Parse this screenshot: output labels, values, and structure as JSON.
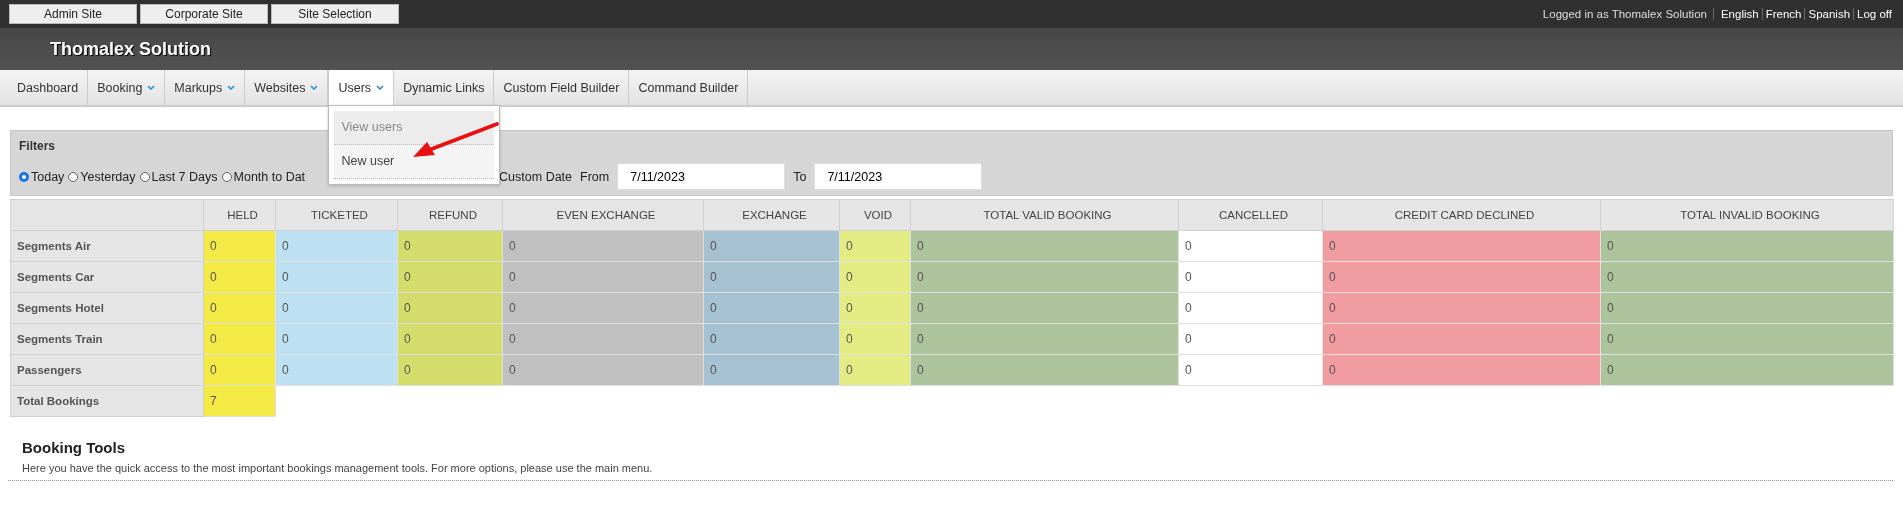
{
  "top_bar": {
    "site_buttons": [
      "Admin Site",
      "Corporate Site",
      "Site Selection"
    ],
    "logged_in": "Logged in as Thomalex Solution",
    "links": [
      "English",
      "French",
      "Spanish",
      "Log off"
    ]
  },
  "header": {
    "title": "Thomalex Solution"
  },
  "nav": [
    {
      "label": "Dashboard",
      "has_menu": false,
      "selected": false
    },
    {
      "label": "Booking",
      "has_menu": true,
      "selected": false
    },
    {
      "label": "Markups",
      "has_menu": true,
      "selected": false
    },
    {
      "label": "Websites",
      "has_menu": true,
      "selected": false
    },
    {
      "label": "Users",
      "has_menu": true,
      "selected": true,
      "menu": [
        {
          "label": "View users",
          "disabled": true
        },
        {
          "label": "New user",
          "disabled": false
        }
      ]
    },
    {
      "label": "Dynamic Links",
      "has_menu": false,
      "selected": false
    },
    {
      "label": "Custom Field Builder",
      "has_menu": false,
      "selected": false
    },
    {
      "label": "Command Builder",
      "has_menu": false,
      "selected": false
    }
  ],
  "filters": {
    "title": "Filters",
    "options": [
      {
        "kind": "radio",
        "label": "Today",
        "selected": true
      },
      {
        "kind": "radio",
        "label": "Yesterday",
        "selected": false
      },
      {
        "kind": "radio",
        "label": "Last 7 Days",
        "selected": false
      },
      {
        "kind": "radio",
        "label": "Month to Dat",
        "selected": false
      },
      {
        "kind": "label",
        "label": "Custom Date"
      }
    ],
    "from_label": "From",
    "from_value": "7/11/2023",
    "to_label": "To",
    "to_value": "7/11/2023"
  },
  "table": {
    "columns": [
      {
        "label": "HELD",
        "color": "#f3ea45"
      },
      {
        "label": "TICKETED",
        "color": "#bde0f2"
      },
      {
        "label": "REFUND",
        "color": "#d4dc6b"
      },
      {
        "label": "EVEN EXCHANGE",
        "color": "#c0c0c0"
      },
      {
        "label": "EXCHANGE",
        "color": "#a5c1d2"
      },
      {
        "label": "VOID",
        "color": "#e3ec82"
      },
      {
        "label": "TOTAL VALID BOOKING",
        "color": "#adc39b"
      },
      {
        "label": "CANCELLED",
        "color": "#ffffff"
      },
      {
        "label": "CREDIT CARD DECLINED",
        "color": "#f09ca0"
      },
      {
        "label": "TOTAL INVALID BOOKING",
        "color": "#adc39b"
      }
    ],
    "rows": [
      {
        "label": "Segments Air",
        "cells": [
          "0",
          "0",
          "0",
          "0",
          "0",
          "0",
          "0",
          "0",
          "0",
          "0"
        ]
      },
      {
        "label": "Segments Car",
        "cells": [
          "0",
          "0",
          "0",
          "0",
          "0",
          "0",
          "0",
          "0",
          "0",
          "0"
        ]
      },
      {
        "label": "Segments Hotel",
        "cells": [
          "0",
          "0",
          "0",
          "0",
          "0",
          "0",
          "0",
          "0",
          "0",
          "0"
        ]
      },
      {
        "label": "Segments Train",
        "cells": [
          "0",
          "0",
          "0",
          "0",
          "0",
          "0",
          "0",
          "0",
          "0",
          "0"
        ]
      },
      {
        "label": "Passengers",
        "cells": [
          "0",
          "0",
          "0",
          "0",
          "0",
          "0",
          "0",
          "0",
          "0",
          "0"
        ]
      },
      {
        "label": "Total Bookings",
        "cells": [
          "7"
        ]
      }
    ]
  },
  "booking_tools": {
    "title": "Booking Tools",
    "text": "Here you have the quick access to the most important bookings management tools. For more options, please use the main menu."
  }
}
